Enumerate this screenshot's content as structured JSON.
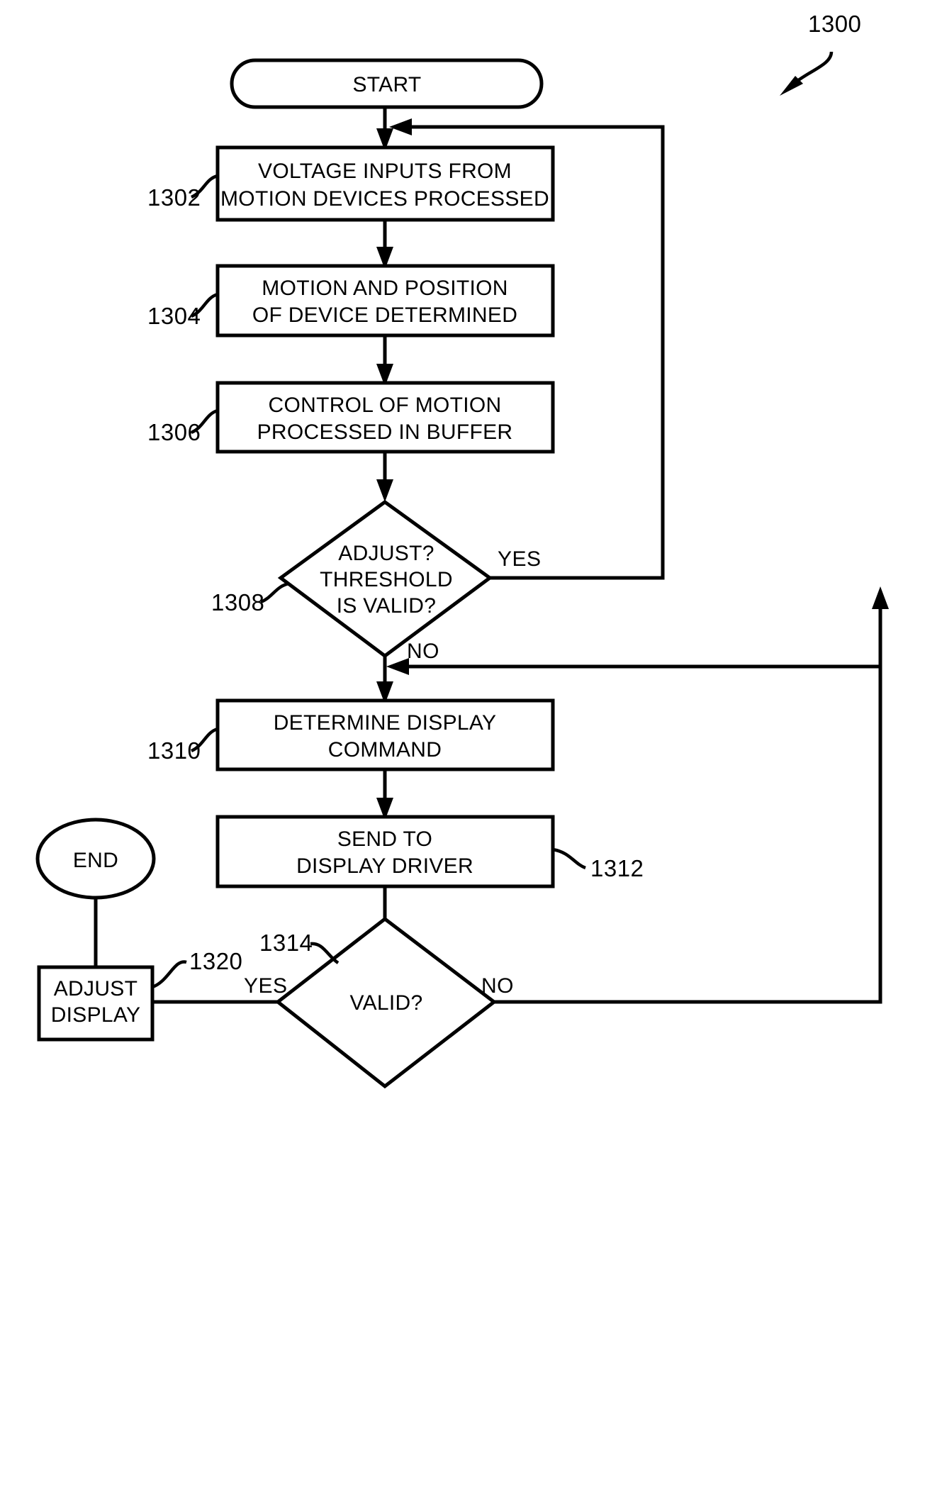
{
  "figure": {
    "ref_numeral": "1300",
    "type": "flowchart"
  },
  "nodes": {
    "start": {
      "label": "START",
      "shape": "stadium"
    },
    "end": {
      "label": "END",
      "shape": "ellipse"
    },
    "n1302": {
      "ref": "1302",
      "line1": "VOLTAGE INPUTS FROM",
      "line2": "MOTION DEVICES PROCESSED",
      "shape": "rect"
    },
    "n1304": {
      "ref": "1304",
      "line1": "MOTION AND POSITION",
      "line2": "OF DEVICE DETERMINED",
      "shape": "rect"
    },
    "n1306": {
      "ref": "1306",
      "line1": "CONTROL OF MOTION",
      "line2": "PROCESSED IN BUFFER",
      "shape": "rect"
    },
    "n1308": {
      "ref": "1308",
      "line1": "ADJUST?",
      "line2": "THRESHOLD",
      "line3": "IS VALID?",
      "shape": "diamond"
    },
    "n1310": {
      "ref": "1310",
      "line1": "DETERMINE DISPLAY",
      "line2": "COMMAND",
      "shape": "rect"
    },
    "n1312": {
      "ref": "1312",
      "line1": "SEND TO",
      "line2": "DISPLAY DRIVER",
      "shape": "rect"
    },
    "n1314": {
      "ref": "1314",
      "line1": "VALID?",
      "shape": "diamond"
    },
    "n1320": {
      "ref": "1320",
      "line1": "ADJUST",
      "line2": "DISPLAY",
      "shape": "rect"
    }
  },
  "edge_labels": {
    "d1308_yes": "YES",
    "d1308_no": "NO",
    "d1314_yes": "YES",
    "d1314_no": "NO"
  },
  "colors": {
    "stroke": "#000000",
    "fill": "#ffffff",
    "background": "#ffffff"
  },
  "chart_data": {
    "type": "diagram",
    "title": "1300",
    "nodes": [
      {
        "id": "start",
        "text": "START",
        "shape": "terminator"
      },
      {
        "id": "1302",
        "text": "VOLTAGE INPUTS FROM MOTION DEVICES PROCESSED",
        "shape": "process"
      },
      {
        "id": "1304",
        "text": "MOTION AND POSITION OF DEVICE DETERMINED",
        "shape": "process"
      },
      {
        "id": "1306",
        "text": "CONTROL OF MOTION PROCESSED IN BUFFER",
        "shape": "process"
      },
      {
        "id": "1308",
        "text": "ADJUST? THRESHOLD IS VALID?",
        "shape": "decision"
      },
      {
        "id": "1310",
        "text": "DETERMINE DISPLAY COMMAND",
        "shape": "process"
      },
      {
        "id": "1312",
        "text": "SEND TO DISPLAY DRIVER",
        "shape": "process"
      },
      {
        "id": "1314",
        "text": "VALID?",
        "shape": "decision"
      },
      {
        "id": "1320",
        "text": "ADJUST DISPLAY",
        "shape": "process"
      },
      {
        "id": "end",
        "text": "END",
        "shape": "terminator"
      }
    ],
    "edges": [
      {
        "from": "start",
        "to": "1302",
        "label": ""
      },
      {
        "from": "1302",
        "to": "1304",
        "label": ""
      },
      {
        "from": "1304",
        "to": "1306",
        "label": ""
      },
      {
        "from": "1306",
        "to": "1308",
        "label": ""
      },
      {
        "from": "1308",
        "to": "1302",
        "label": "YES"
      },
      {
        "from": "1308",
        "to": "1310",
        "label": "NO"
      },
      {
        "from": "1310",
        "to": "1312",
        "label": ""
      },
      {
        "from": "1312",
        "to": "1314",
        "label": ""
      },
      {
        "from": "1314",
        "to": "1320",
        "label": "YES"
      },
      {
        "from": "1314",
        "to": "1308",
        "label": "NO"
      },
      {
        "from": "1320",
        "to": "end",
        "label": ""
      }
    ]
  }
}
